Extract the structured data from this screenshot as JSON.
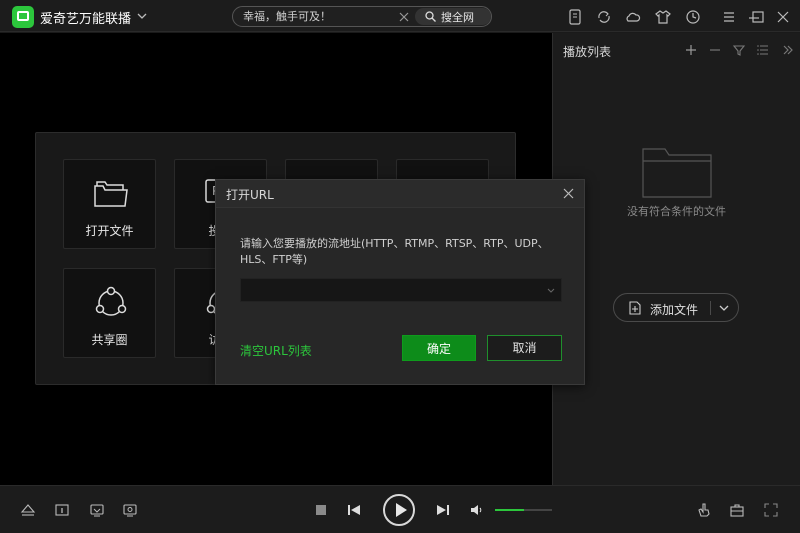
{
  "app": {
    "title": "爱奇艺万能联播"
  },
  "search": {
    "value": "幸福，触手可及！",
    "button_label": "搜全网"
  },
  "tiles": [
    {
      "label": "打开文件",
      "icon": "folder-icon"
    },
    {
      "label": "投屏",
      "icon": "cast-icon"
    },
    {
      "label": "",
      "icon": "camera-icon"
    },
    {
      "label": "",
      "icon": "wireless-icon"
    },
    {
      "label": "共享圈",
      "icon": "share-circle-icon"
    },
    {
      "label": "访问",
      "icon": "share-icon"
    }
  ],
  "playlist": {
    "title": "播放列表",
    "empty_text": "没有符合条件的文件",
    "add_label": "添加文件"
  },
  "dialog": {
    "title": "打开URL",
    "prompt": "请输入您要播放的流地址(HTTP、RTMP、RTSP、RTP、UDP、HLS、FTP等)",
    "url_value": "",
    "clear_label": "清空URL列表",
    "ok_label": "确定",
    "cancel_label": "取消"
  },
  "player": {
    "volume": 0.5
  },
  "colors": {
    "accent": "#2cc63c",
    "ok_button": "#0d8c1a"
  }
}
